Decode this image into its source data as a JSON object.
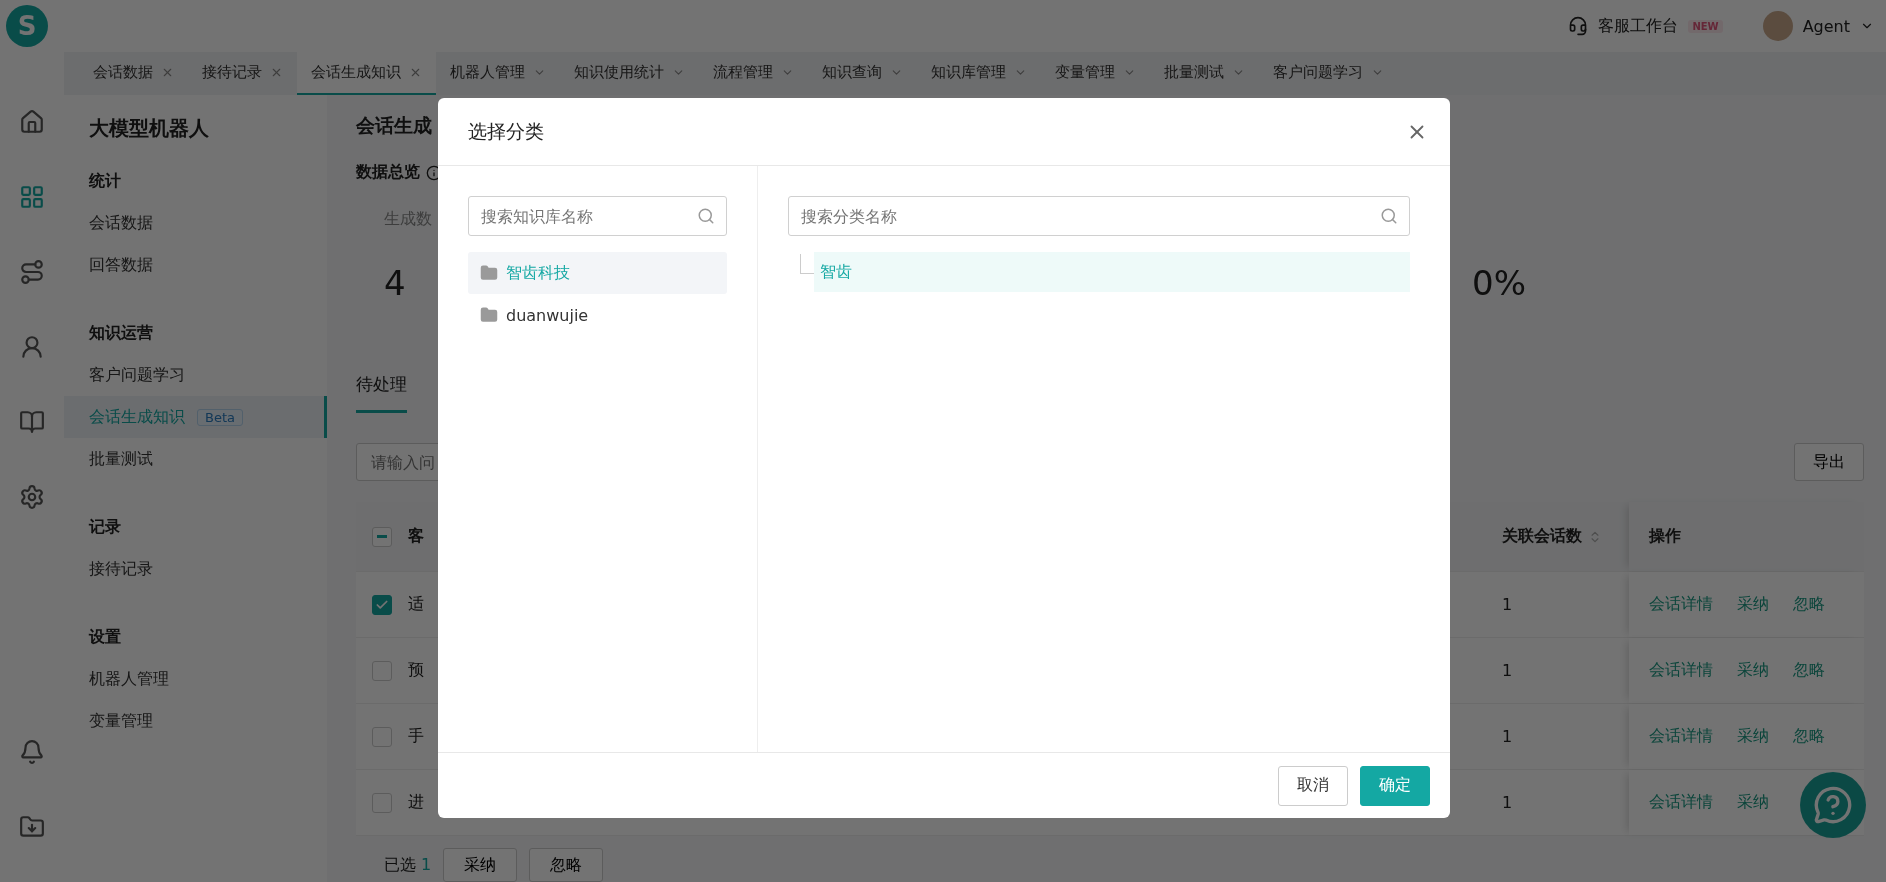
{
  "header": {
    "logo": "S",
    "workbench": "客服工作台",
    "badge": "NEW",
    "user": "Agent"
  },
  "rail": [
    {
      "kind": "home",
      "selected": false
    },
    {
      "kind": "apps",
      "selected": true
    },
    {
      "kind": "route",
      "selected": false
    },
    {
      "kind": "person",
      "selected": false
    },
    {
      "kind": "book",
      "selected": false
    },
    {
      "kind": "settings",
      "selected": false
    },
    {
      "kind": "bell",
      "selected": false
    },
    {
      "kind": "download",
      "selected": false
    }
  ],
  "tabs": [
    {
      "label": "会话数据",
      "kind": "closable",
      "selected": false
    },
    {
      "label": "接待记录",
      "kind": "closable",
      "selected": false
    },
    {
      "label": "会话生成知识",
      "kind": "closable",
      "selected": true
    },
    {
      "label": "机器人管理",
      "kind": "menu",
      "selected": false
    },
    {
      "label": "知识使用统计",
      "kind": "menu",
      "selected": false
    },
    {
      "label": "流程管理",
      "kind": "menu",
      "selected": false
    },
    {
      "label": "知识查询",
      "kind": "menu",
      "selected": false
    },
    {
      "label": "知识库管理",
      "kind": "menu",
      "selected": false
    },
    {
      "label": "变量管理",
      "kind": "menu",
      "selected": false
    },
    {
      "label": "批量测试",
      "kind": "menu",
      "selected": false
    },
    {
      "label": "客户问题学习",
      "kind": "menu",
      "selected": false
    }
  ],
  "sidebar": {
    "title": "大模型机器人",
    "groups": [
      {
        "heading": "统计",
        "items": [
          {
            "label": "会话数据",
            "selected": false
          },
          {
            "label": "回答数据",
            "selected": false
          }
        ]
      },
      {
        "heading": "知识运营",
        "items": [
          {
            "label": "客户问题学习",
            "selected": false
          },
          {
            "label": "会话生成知识",
            "selected": true,
            "badge": "Beta"
          },
          {
            "label": "批量测试",
            "selected": false
          }
        ]
      },
      {
        "heading": "记录",
        "items": [
          {
            "label": "接待记录",
            "selected": false
          }
        ]
      },
      {
        "heading": "设置",
        "items": [
          {
            "label": "机器人管理",
            "selected": false
          },
          {
            "label": "变量管理",
            "selected": false
          }
        ]
      }
    ]
  },
  "page": {
    "title": "会话生成",
    "overview": "数据总览",
    "stats": [
      {
        "label": "生成数",
        "value": "4"
      },
      {
        "value": "0%"
      }
    ],
    "tabs": [
      {
        "label": "待处理",
        "selected": true
      }
    ],
    "search": {
      "placeholder": "请输入问"
    },
    "export": "导出",
    "table": {
      "select_all": {
        "indeterminate": true
      },
      "columns": [
        "客",
        "关联会话数",
        "操作"
      ],
      "rows": [
        {
          "checked": true,
          "column_1": "适",
          "sessions": "1",
          "actions": [
            "会话详情",
            "采纳",
            "忽略"
          ]
        },
        {
          "checked": false,
          "column_1": "预",
          "sessions": "1",
          "actions": [
            "会话详情",
            "采纳",
            "忽略"
          ]
        },
        {
          "checked": false,
          "column_1": "手",
          "sessions": "1",
          "actions": [
            "会话详情",
            "采纳",
            "忽略"
          ]
        },
        {
          "checked": false,
          "column_1": "进",
          "sessions": "1",
          "actions": [
            "会话详情",
            "采纳"
          ]
        }
      ]
    },
    "footer": {
      "selected_label": "已选",
      "selected_count": "1",
      "buttons": [
        "采纳",
        "忽略"
      ]
    }
  },
  "modal": {
    "title": "选择分类",
    "kb_search": {
      "placeholder": "搜索知识库名称"
    },
    "knowledge_bases": [
      {
        "label": "智齿科技",
        "selected": true
      },
      {
        "label": "duanwujie",
        "selected": false
      }
    ],
    "category_search": {
      "placeholder": "搜索分类名称"
    },
    "categories": [
      {
        "label": "智齿",
        "selected": true
      }
    ],
    "buttons": [
      {
        "label": "取消",
        "kind": "default"
      },
      {
        "label": "确定",
        "kind": "primary"
      }
    ]
  }
}
